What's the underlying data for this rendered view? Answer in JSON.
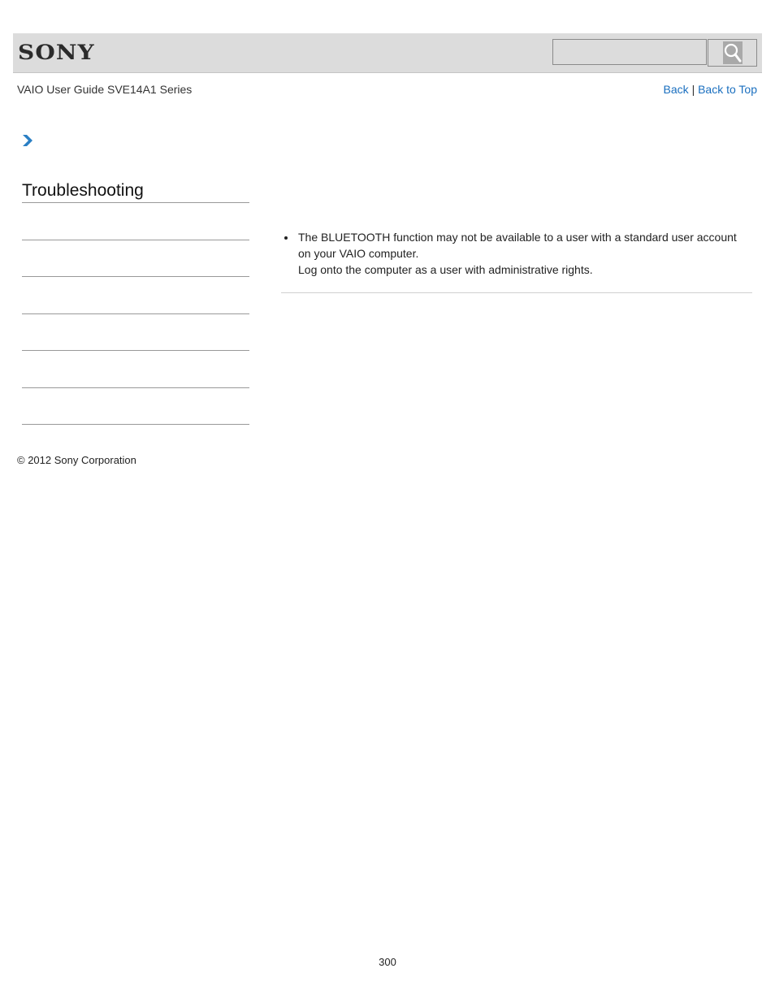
{
  "header": {
    "logo": "SONY",
    "search": {
      "value": "",
      "placeholder": ""
    },
    "search_icon": "magnifier-icon"
  },
  "subheader": {
    "guide_title": "VAIO User Guide SVE14A1 Series",
    "back_label": "Back",
    "separator": "|",
    "back_to_top_label": "Back to Top"
  },
  "breadcrumb": {
    "icon": "chevron-right-icon",
    "accent_color": "#2a7fc4"
  },
  "sidebar": {
    "section_title": "Troubleshooting",
    "item_count": 6
  },
  "content": {
    "bullets": [
      {
        "lines": [
          "The BLUETOOTH function may not be available to a user with a standard user account on your VAIO computer.",
          "Log onto the computer as a user with administrative rights."
        ]
      }
    ]
  },
  "footer": {
    "copyright": "© 2012 Sony Corporation",
    "page_number": "300"
  },
  "colors": {
    "link": "#1a6fbf",
    "header_bg": "#dcdcdc"
  }
}
